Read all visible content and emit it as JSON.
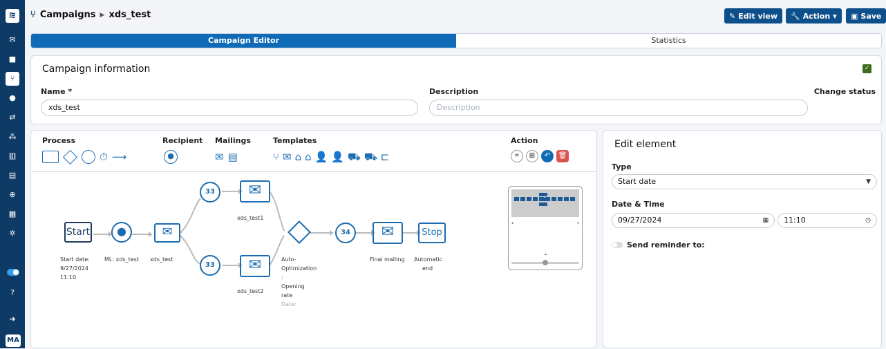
{
  "sidebar": {
    "logo": "≋",
    "items": [
      "mail-icon",
      "folder-icon",
      "workflow-icon",
      "user-icon",
      "transfer-icon",
      "users-icon",
      "chart-icon",
      "list-icon",
      "plus-icon",
      "grid-icon",
      "gear-icon"
    ],
    "bottom": [
      "toggle",
      "help-icon",
      "logout-icon"
    ],
    "avatar": "MA"
  },
  "breadcrumb": {
    "root": "Campaigns",
    "current": "xds_test"
  },
  "toolbar": {
    "edit_view": "Edit view",
    "action": "Action",
    "save": "Save"
  },
  "tabs": [
    {
      "label": "Campaign Editor",
      "active": true
    },
    {
      "label": "Statistics",
      "active": false
    }
  ],
  "campaign_info": {
    "title": "Campaign information",
    "name_label": "Name *",
    "name_value": "xds_test",
    "description_label": "Description",
    "description_placeholder": "Description",
    "change_status_label": "Change status",
    "status_checked": true
  },
  "editor": {
    "groups": {
      "process": "Process",
      "recipient": "Recipient",
      "mailings": "Mailings",
      "templates": "Templates",
      "action": "Action"
    },
    "nodes": {
      "start": "Start",
      "start_label": [
        "Start date:",
        "9/27/2024",
        "11:10"
      ],
      "ml_label": "ML: xds_test",
      "mailing_label": "xds_test",
      "delay_a": "33",
      "delay_b": "33",
      "test1": "xds_test1",
      "test2": "xds_test2",
      "auto_opt": [
        "Auto-",
        "Optimization",
        ":",
        "Opening",
        "rate"
      ],
      "auto_opt_dim": "Date:",
      "delay_c": "34",
      "final": "Final mailing",
      "stop": "Stop",
      "auto_end": [
        "Automatic",
        "end"
      ]
    }
  },
  "edit_element": {
    "title": "Edit element",
    "type_label": "Type",
    "type_value": "Start date",
    "datetime_label": "Date & Time",
    "date_value": "09/27/2024",
    "time_value": "11:10",
    "reminder_label": "Send reminder to:"
  },
  "colors": {
    "nav": "#0d3b66",
    "accent": "#0f6bb8",
    "node": "#1b6cb0",
    "status": "#3d6b1f",
    "delete": "#d9534f"
  }
}
